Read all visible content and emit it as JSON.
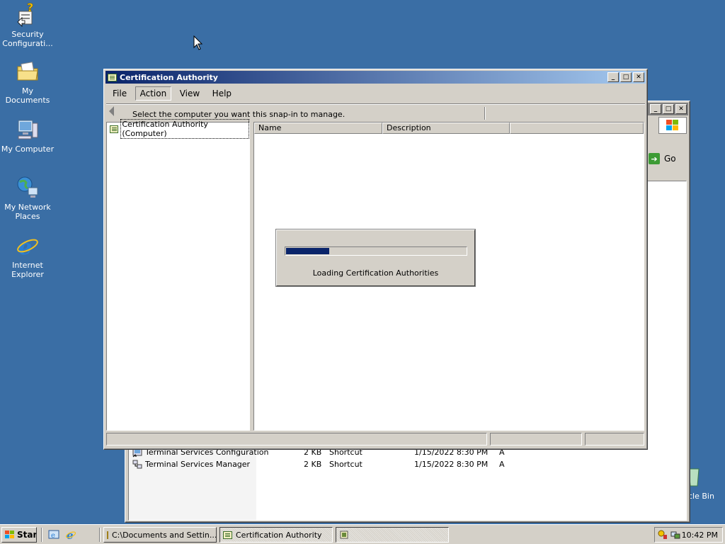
{
  "desktop": {
    "icons": [
      {
        "label": "Security Configurati...",
        "icon": "security-config-icon"
      },
      {
        "label": "My Documents",
        "icon": "my-documents-icon"
      },
      {
        "label": "My Computer",
        "icon": "my-computer-icon"
      },
      {
        "label": "My Network Places",
        "icon": "network-places-icon"
      },
      {
        "label": "Internet Explorer",
        "icon": "internet-explorer-icon"
      },
      {
        "label": "cle Bin",
        "icon": "recycle-bin-icon"
      }
    ]
  },
  "explorer_window": {
    "go_label": "Go",
    "files": [
      {
        "name": "Terminal Services Configuration",
        "size": "2 KB",
        "type": "Shortcut",
        "modified": "1/15/2022 8:30 PM",
        "attr": "A"
      },
      {
        "name": "Terminal Services Manager",
        "size": "2 KB",
        "type": "Shortcut",
        "modified": "1/15/2022 8:30 PM",
        "attr": "A"
      }
    ]
  },
  "ca_window": {
    "title": "Certification Authority",
    "menu": [
      "File",
      "Action",
      "View",
      "Help"
    ],
    "toolbar_hint": "Select the computer you want this snap-in to manage.",
    "tree_item": "Certification Authority (Computer)",
    "columns": [
      "Name",
      "Description"
    ],
    "progress": {
      "message": "Loading Certification Authorities",
      "fraction": 0.24,
      "color": "#0a246a"
    }
  },
  "taskbar": {
    "start_label": "Start",
    "tasks": [
      "C:\\Documents and Settin...",
      "Certification Authority"
    ],
    "clock": "10:42 PM"
  },
  "colors": {
    "desktop": "#3a6ea5",
    "title_active_start": "#0a246a",
    "title_active_end": "#a6caf0",
    "face": "#d4d0c8"
  }
}
